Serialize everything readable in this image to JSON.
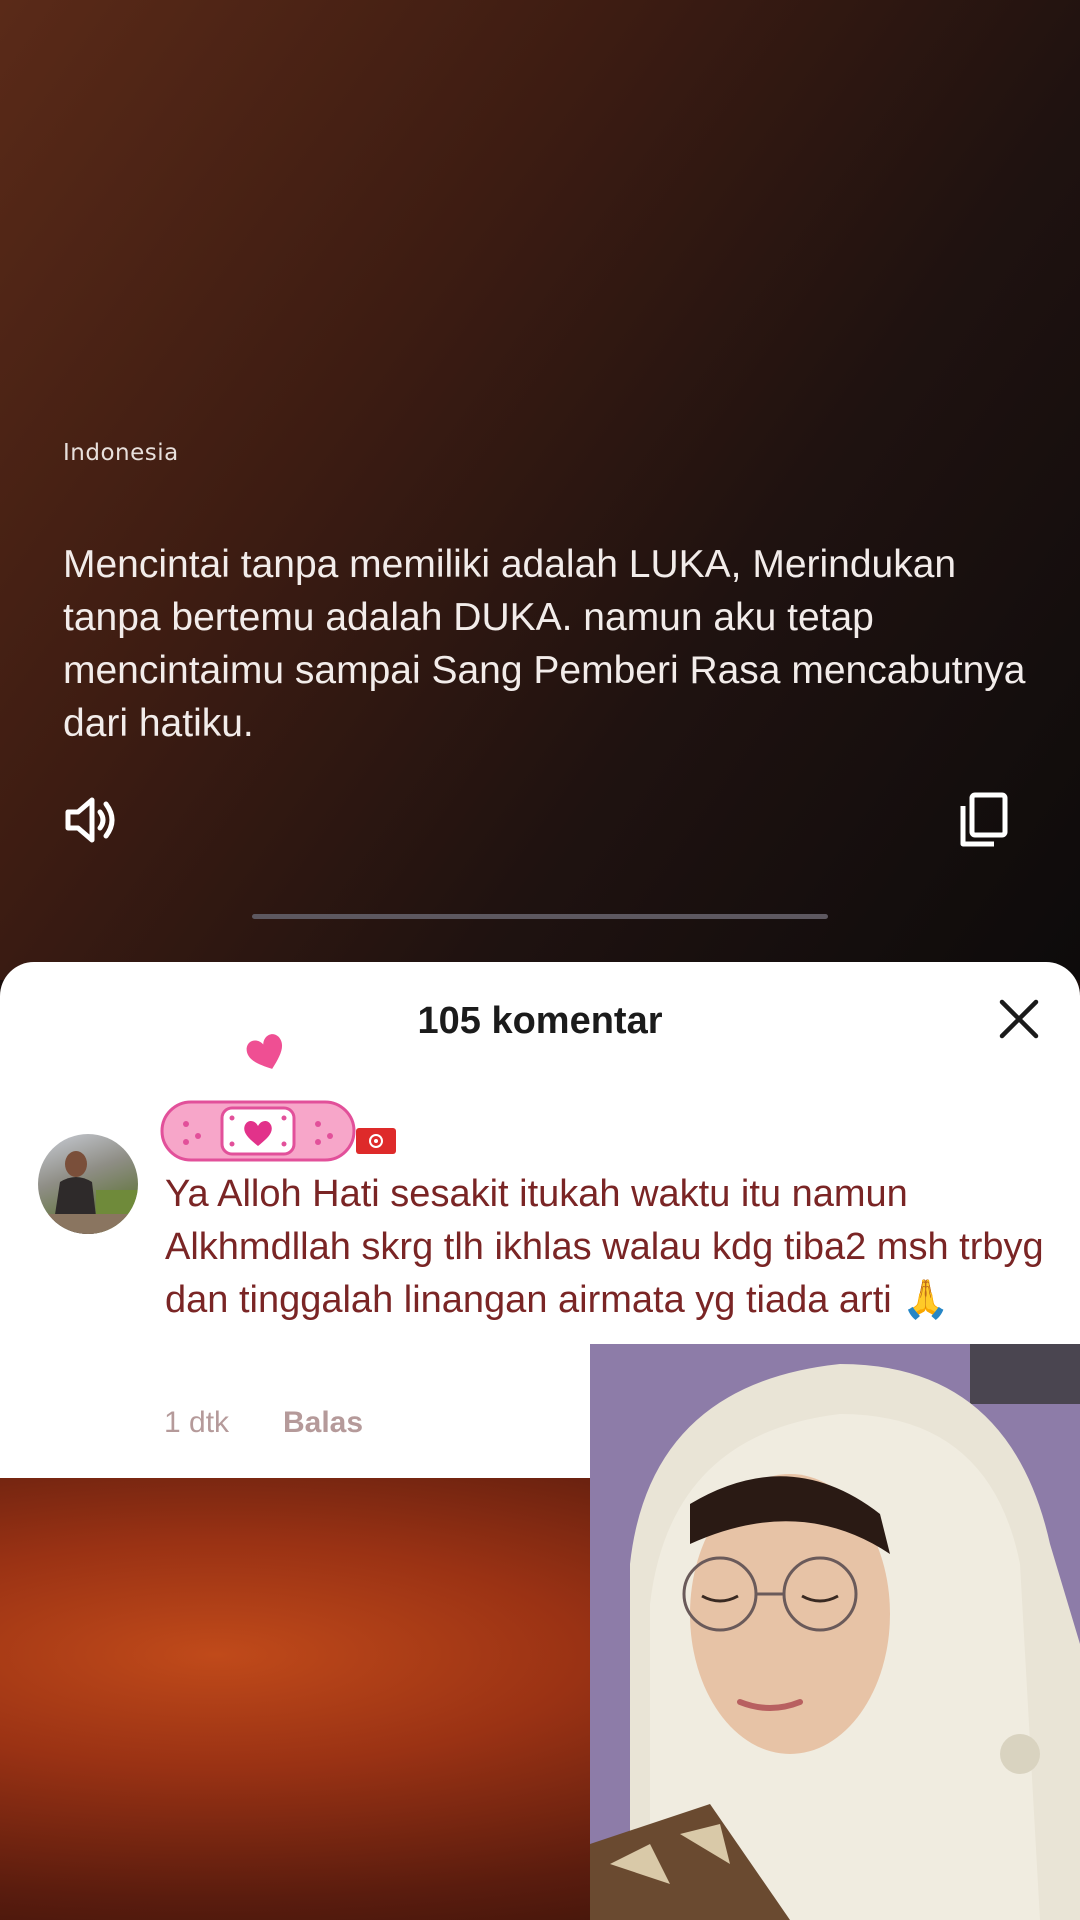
{
  "translation": {
    "language": "Indonesia",
    "text": "Mencintai tanpa memiliki adalah LUKA, Merindukan tanpa bertemu adalah DUKA. namun aku tetap mencintaimu sampai Sang Pemberi Rasa mencabutnya dari hatiku.",
    "speaker_icon": "speaker-icon",
    "copy_icon": "copy-icon"
  },
  "comments_sheet": {
    "title": "105 komentar",
    "close_icon": "close-icon"
  },
  "comment": {
    "text": "Ya Alloh Hati sesakit itukah waktu itu namun Alkhmdllah skrg tlh ikhlas walau kdg tiba2 msh trbyg dan tinggalah linangan airmata yg tiada arti 🙏",
    "time": "1 dtk",
    "reply_label": "Balas",
    "badge_icon": "bandage-heart-icon",
    "flag_icon": "hong-kong-flag-icon"
  },
  "colors": {
    "comment_text": "#7a2525",
    "meta_text": "#b59a9a",
    "badge_pink": "#f7a6c9"
  }
}
